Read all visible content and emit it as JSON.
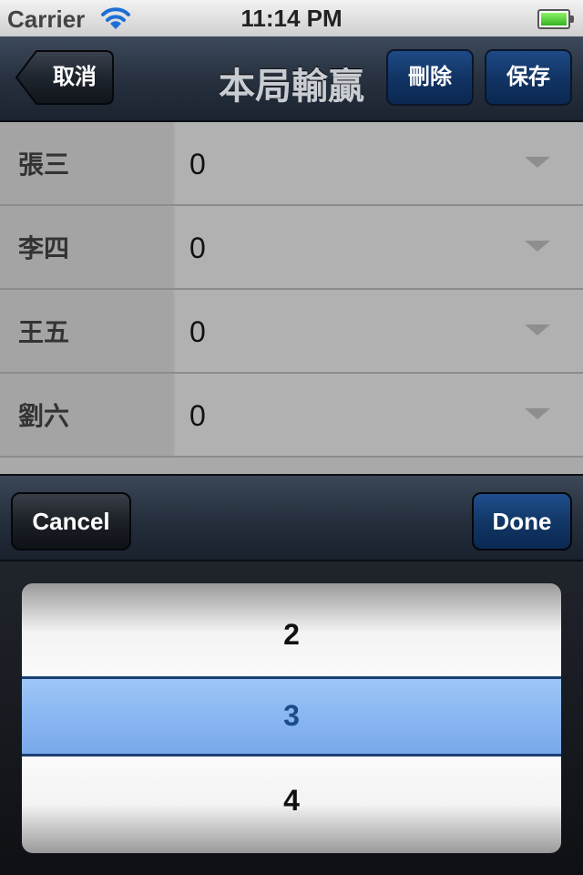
{
  "status_bar": {
    "carrier": "Carrier",
    "time": "11:14 PM",
    "wifi_icon": "wifi-icon",
    "battery_icon": "battery-icon"
  },
  "nav": {
    "back_label": "取消",
    "title": "本局輸贏",
    "delete_label": "刪除",
    "save_label": "保存"
  },
  "rows": [
    {
      "name": "張三",
      "value": "0"
    },
    {
      "name": "李四",
      "value": "0"
    },
    {
      "name": "王五",
      "value": "0"
    },
    {
      "name": "劉六",
      "value": "0"
    }
  ],
  "toolbar": {
    "cancel_label": "Cancel",
    "done_label": "Done"
  },
  "picker": {
    "options": [
      "2",
      "3",
      "4"
    ],
    "selected": "3"
  },
  "colors": {
    "nav_dark": "#1b2330",
    "accent_blue": "#123465",
    "picker_selection": "#8ab7f2"
  }
}
